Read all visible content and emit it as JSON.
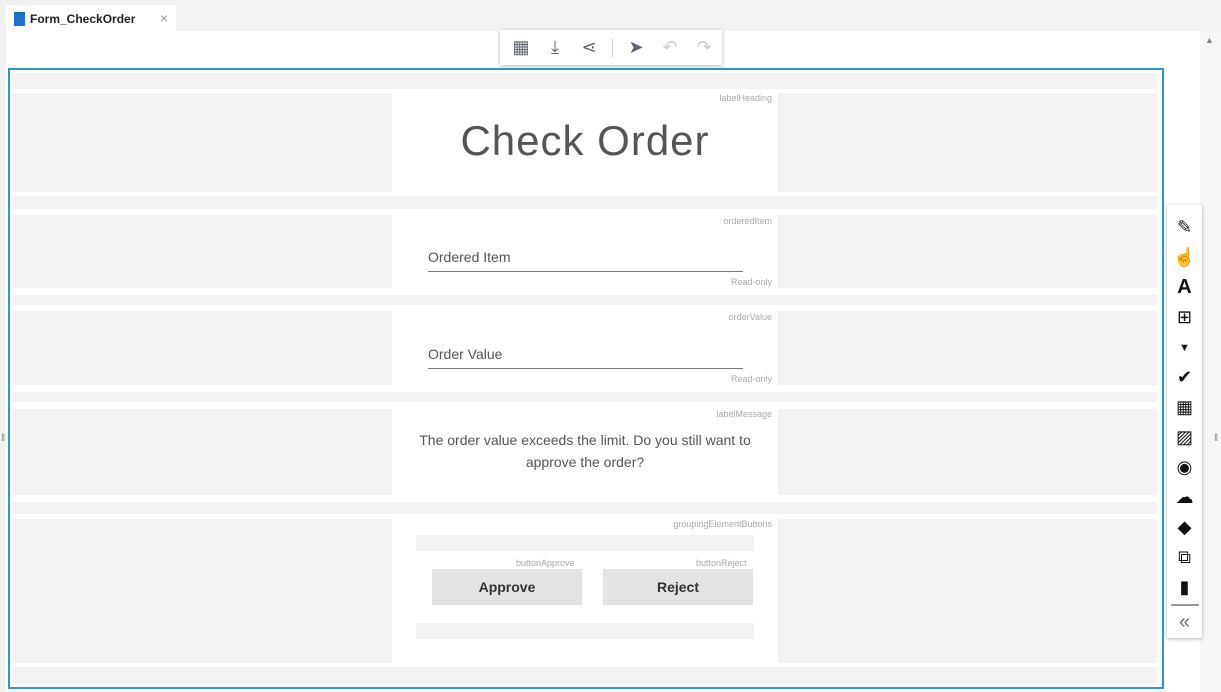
{
  "tab": {
    "title": "Form_CheckOrder",
    "close": "×"
  },
  "form": {
    "heading": {
      "tag": "labelHeading",
      "text": "Check Order"
    },
    "orderedItem": {
      "tag": "orderedItem",
      "label": "Ordered Item",
      "status": "Read-only"
    },
    "orderValue": {
      "tag": "orderValue",
      "label": "Order Value",
      "status": "Read-only"
    },
    "message": {
      "tag": "labelMessage",
      "text": "The order value exceeds the limit. Do you still want to approve the order?"
    },
    "buttons": {
      "tag": "groupingElementButtons",
      "approve_tag": "buttonApprove",
      "approve": "Approve",
      "reject_tag": "buttonReject",
      "reject": "Reject"
    }
  },
  "accent": "#2e95d3"
}
